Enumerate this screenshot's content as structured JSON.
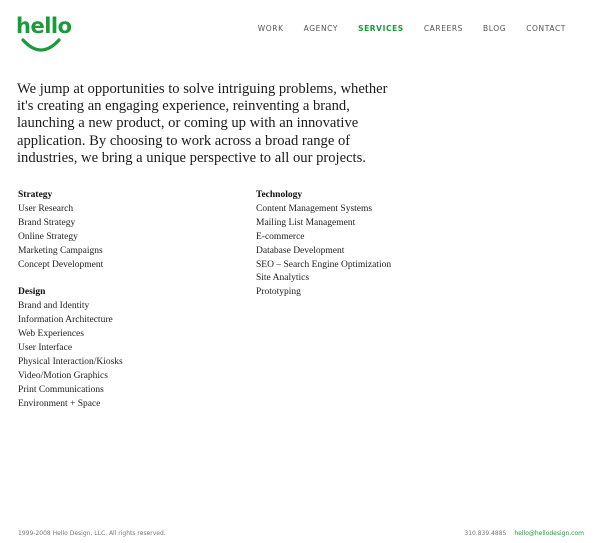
{
  "brand": {
    "logo_text": "hello",
    "accent_color": "#1a9b3b"
  },
  "nav": {
    "items": [
      {
        "label": "WORK"
      },
      {
        "label": "AGENCY"
      },
      {
        "label": "SERVICES"
      },
      {
        "label": "CAREERS"
      },
      {
        "label": "BLOG"
      },
      {
        "label": "CONTACT"
      }
    ],
    "active": "SERVICES"
  },
  "intro": {
    "text": "We jump at opportunities to solve intriguing problems, whether it's creating an engaging experience, reinventing a brand, launching a new product, or coming up with an innovative application. By choosing to work across a broad range of industries, we bring a unique perspective to all our projects."
  },
  "services": {
    "strategy": {
      "heading": "Strategy",
      "items": [
        "User Research",
        "Brand Strategy",
        "Online Strategy",
        "Marketing Campaigns",
        "Concept Development"
      ]
    },
    "design": {
      "heading": "Design",
      "items": [
        "Brand and Identity",
        "Information Architecture",
        "Web Experiences",
        "User Interface",
        "Physical Interaction/Kiosks",
        "Video/Motion Graphics",
        "Print Communications",
        "Environment + Space"
      ]
    },
    "technology": {
      "heading": "Technology",
      "items": [
        "Content Management Systems",
        "Mailing List Management",
        "E-commerce",
        "Database Development",
        "SEO – Search Engine Optimization",
        "Site Analytics",
        "Prototyping"
      ]
    }
  },
  "footer": {
    "copyright": "1999-2008 Hello Design, LLC. All rights reserved.",
    "phone": "310.839.4885",
    "email": "hello@hellodesign.com"
  }
}
